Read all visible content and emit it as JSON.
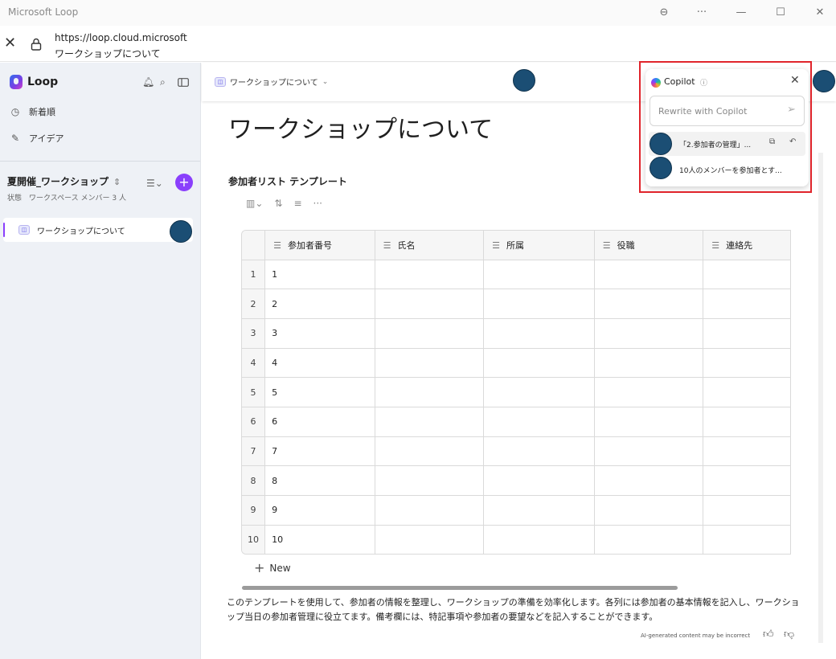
{
  "window": {
    "title": "Microsoft Loop",
    "controls": [
      "⊖",
      "···",
      "—",
      "☐",
      "✕"
    ]
  },
  "address": {
    "url": "https://loop.cloud.microsoft",
    "page_title": "ワークショップについて"
  },
  "sidebar": {
    "app_name": "Loop",
    "nav": [
      {
        "icon": "clock-icon",
        "glyph": "◷",
        "label": "新着順"
      },
      {
        "icon": "pen-icon",
        "glyph": "✎",
        "label": "アイデア"
      }
    ],
    "workspace": {
      "name": "夏開催_ワークショップ",
      "chevron": "⇕",
      "status": "状態　ワークスペース メンバー 3 人"
    },
    "pages": [
      {
        "label": "ワークショップについて",
        "selected": true
      }
    ]
  },
  "header": {
    "breadcrumb": "ワークショップについて"
  },
  "document": {
    "title": "ワークショップについて",
    "table_title": "参加者リスト テンプレート",
    "columns": [
      "参加者番号",
      "氏名",
      "所属",
      "役職",
      "連絡先"
    ],
    "rows": [
      [
        "1",
        "1",
        "",
        "",
        "",
        ""
      ],
      [
        "2",
        "2",
        "",
        "",
        "",
        ""
      ],
      [
        "3",
        "3",
        "",
        "",
        "",
        ""
      ],
      [
        "4",
        "4",
        "",
        "",
        "",
        ""
      ],
      [
        "5",
        "5",
        "",
        "",
        "",
        ""
      ],
      [
        "6",
        "6",
        "",
        "",
        "",
        ""
      ],
      [
        "7",
        "7",
        "",
        "",
        "",
        ""
      ],
      [
        "8",
        "8",
        "",
        "",
        "",
        ""
      ],
      [
        "9",
        "9",
        "",
        "",
        "",
        ""
      ],
      [
        "10",
        "10",
        "",
        "",
        "",
        ""
      ]
    ],
    "new_label": "New",
    "description": "このテンプレートを使用して、参加者の情報を整理し、ワークショップの準備を効率化します。各列には参加者の基本情報を記入し、ワークショップ当日の参加者管理に役立てます。備考欄には、特記事項や参加者の要望などを記入することができます。",
    "ai_note": "AI-generated content may be incorrect"
  },
  "copilot": {
    "title": "Copilot",
    "placeholder": "Rewrite with Copilot",
    "suggestions": [
      "「2.参加者の管理」...",
      "10人のメンバーを参加者とす..."
    ]
  },
  "colors": {
    "accent": "#8a3ffc",
    "highlight": "#e0242b",
    "marker": "#1b4e74",
    "sidebar_bg": "#eef1f6"
  }
}
